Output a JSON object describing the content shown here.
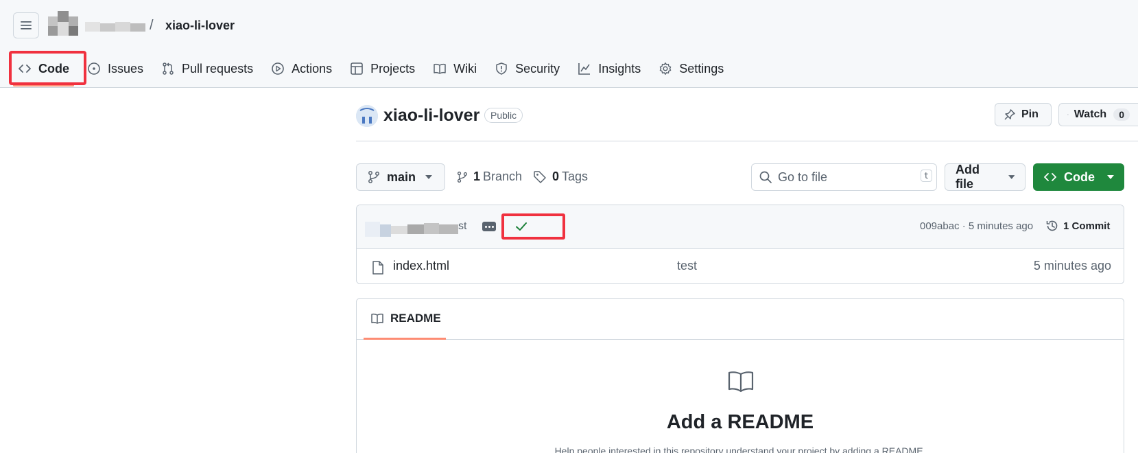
{
  "breadcrumb": {
    "separator": "/",
    "repo": "xiao-li-lover"
  },
  "nav": {
    "items": [
      {
        "label": "Code",
        "icon": "code-icon",
        "active": true
      },
      {
        "label": "Issues",
        "icon": "issue-icon"
      },
      {
        "label": "Pull requests",
        "icon": "pull-request-icon"
      },
      {
        "label": "Actions",
        "icon": "play-icon"
      },
      {
        "label": "Projects",
        "icon": "table-icon"
      },
      {
        "label": "Wiki",
        "icon": "book-icon"
      },
      {
        "label": "Security",
        "icon": "shield-icon"
      },
      {
        "label": "Insights",
        "icon": "graph-icon"
      },
      {
        "label": "Settings",
        "icon": "gear-icon"
      }
    ]
  },
  "repo": {
    "name": "xiao-li-lover",
    "visibility": "Public",
    "pin_label": "Pin",
    "watch_label": "Watch",
    "watch_count": "0"
  },
  "toolbar": {
    "branch": "main",
    "branch_count": "1",
    "branch_label": "Branch",
    "tag_count": "0",
    "tag_label": "Tags",
    "search_placeholder": "Go to file",
    "search_shortcut": "t",
    "add_file_label": "Add file",
    "code_button_label": "Code"
  },
  "commit": {
    "message_tail": "st",
    "status": "success",
    "hash_and_time": "009abac · 5 minutes ago",
    "count_label": "1 Commit"
  },
  "files": [
    {
      "name": "index.html",
      "message": "test",
      "time": "5 minutes ago",
      "icon": "file-icon"
    }
  ],
  "readme": {
    "tab_label": "README",
    "heading": "Add a README",
    "text": "Help people interested in this repository understand your project by adding a README."
  },
  "colors": {
    "accent_underline": "#fd8c73",
    "primary_button": "#1f883d",
    "annotation_box": "#f0313f",
    "success_check": "#1a7f37"
  }
}
